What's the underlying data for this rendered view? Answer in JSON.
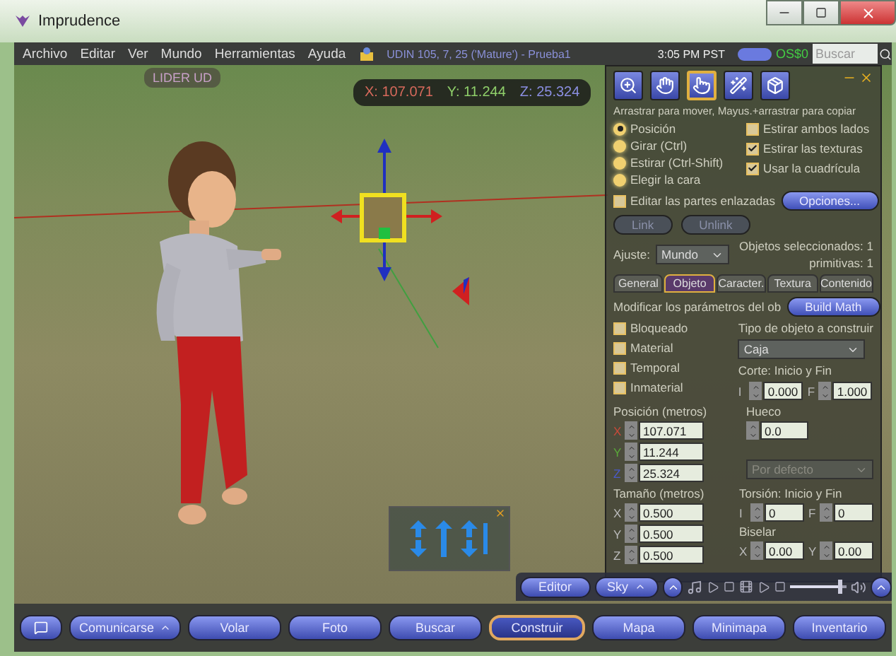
{
  "window": {
    "title": "Imprudence"
  },
  "menu": {
    "items": [
      "Archivo",
      "Editar",
      "Ver",
      "Mundo",
      "Herramientas",
      "Ayuda"
    ],
    "location": "UDIN 105, 7, 25 ('Mature') - Prueba1",
    "time": "3:05 PM PST",
    "balance": "OS$0",
    "search": {
      "placeholder": "Buscar"
    }
  },
  "viewport": {
    "tag": "LIDER UD",
    "coords": [
      {
        "text": "X: 107.071",
        "color": "#d86a5c"
      },
      {
        "text": "Y: 11.244",
        "color": "#8fcf6a"
      },
      {
        "text": "Z: 25.324",
        "color": "#8a8ee0"
      }
    ]
  },
  "build_panel": {
    "tools": [
      {
        "kind": "zoom",
        "selected": false
      },
      {
        "kind": "grab",
        "selected": false
      },
      {
        "kind": "edit",
        "selected": true
      },
      {
        "kind": "create",
        "selected": false
      },
      {
        "kind": "land",
        "selected": false
      }
    ],
    "hint": "Arrastrar para mover, Mayus.+arrastrar para copiar",
    "modes": [
      {
        "label": "Posición",
        "selected": true
      },
      {
        "label": "Girar (Ctrl)",
        "selected": false
      },
      {
        "label": "Estirar (Ctrl-Shift)",
        "selected": false
      },
      {
        "label": "Elegir la cara",
        "selected": false
      }
    ],
    "options": [
      {
        "label": "Estirar ambos lados",
        "checked": false
      },
      {
        "label": "Estirar las texturas",
        "checked": true
      },
      {
        "label": "Usar la cuadrícula",
        "checked": true
      }
    ],
    "edit_linked": {
      "label": "Editar las partes enlazadas",
      "checked": false
    },
    "options_button": "Opciones...",
    "link_buttons": [
      {
        "label": "Link",
        "disabled": true
      },
      {
        "label": "Unlink",
        "disabled": true
      }
    ],
    "snap": {
      "label": "Ajuste:",
      "value": "Mundo"
    },
    "selection": [
      "Objetos seleccionados: 1",
      "primitivas: 1"
    ],
    "tabs": [
      {
        "label": "General",
        "selected": false
      },
      {
        "label": "Objeto",
        "selected": true
      },
      {
        "label": "Caracter.",
        "selected": false
      },
      {
        "label": "Textura",
        "selected": false
      },
      {
        "label": "Contenido",
        "selected": false
      }
    ],
    "object": {
      "heading": "Modificar los parámetros del ob",
      "math_button": "Build Math",
      "flags": [
        {
          "label": "Bloqueado",
          "checked": false
        },
        {
          "label": "Material",
          "checked": false
        },
        {
          "label": "Temporal",
          "checked": false
        },
        {
          "label": "Inmaterial",
          "checked": false
        }
      ],
      "type_label": "Tipo de objeto a construir",
      "type_value": "Caja",
      "cut": {
        "label": "Corte: Inicio y Fin",
        "fields": [
          {
            "axis": "I",
            "value": "0.000"
          },
          {
            "axis": "F",
            "value": "1.000"
          }
        ]
      },
      "position": {
        "label": "Posición (metros)",
        "fields": [
          {
            "axis": "X",
            "value": "107.071",
            "color": "#c84a3a"
          },
          {
            "axis": "Y",
            "value": "11.244",
            "color": "#5aa83a"
          },
          {
            "axis": "Z",
            "value": "25.324",
            "color": "#4a5ac8"
          }
        ]
      },
      "hollow": {
        "label": "Hueco",
        "value": "0.0"
      },
      "hole_shape": {
        "value": "Por defecto",
        "disabled": true
      },
      "size": {
        "label": "Tamaño (metros)",
        "fields": [
          {
            "axis": "X",
            "value": "0.500"
          },
          {
            "axis": "Y",
            "value": "0.500"
          },
          {
            "axis": "Z",
            "value": "0.500"
          }
        ]
      },
      "twist": {
        "label": "Torsión: Inicio y Fin",
        "fields": [
          {
            "axis": "I",
            "value": "0"
          },
          {
            "axis": "F",
            "value": "0"
          }
        ]
      },
      "taper": {
        "label": "Biselar",
        "fields": [
          {
            "axis": "X",
            "value": "0.00"
          },
          {
            "axis": "Y",
            "value": "0.00"
          }
        ]
      }
    }
  },
  "media_bar": {
    "buttons": [
      "Editor",
      "Sky"
    ],
    "volume": {
      "level": 0.9
    }
  },
  "toolbar": [
    {
      "label": "Comunicarse",
      "kind": "split",
      "selected": false
    },
    {
      "label": "Volar",
      "kind": "plain",
      "selected": false
    },
    {
      "label": "Foto",
      "kind": "plain",
      "selected": false
    },
    {
      "label": "Buscar",
      "kind": "plain",
      "selected": false
    },
    {
      "label": "Construir",
      "kind": "plain",
      "selected": true
    },
    {
      "label": "Mapa",
      "kind": "plain",
      "selected": false
    },
    {
      "label": "Minimapa",
      "kind": "plain",
      "selected": false
    },
    {
      "label": "Inventario",
      "kind": "plain",
      "selected": false
    }
  ]
}
